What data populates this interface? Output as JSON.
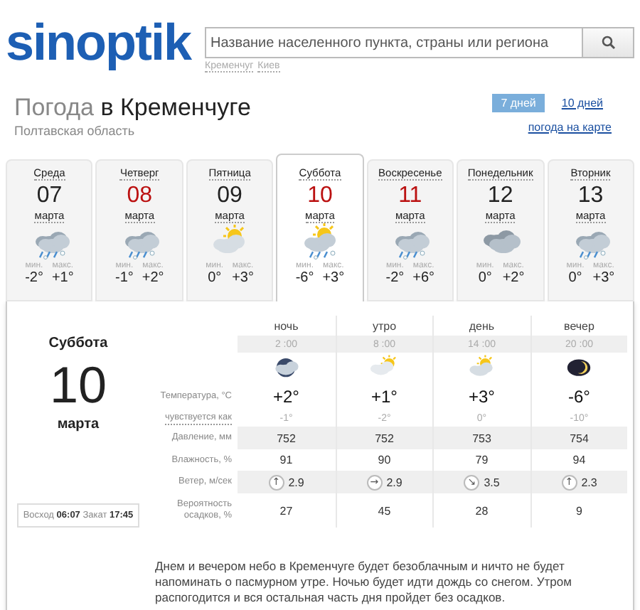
{
  "logo": {
    "text": "sinoptik"
  },
  "search": {
    "placeholder": "Название населенного пункта, страны или региона",
    "recent": [
      "Кременчуг",
      "Киев"
    ]
  },
  "title": {
    "prefix": "Погода",
    "city": "в Кременчуге",
    "region": "Полтавская область"
  },
  "views": [
    {
      "label": "7 дней",
      "selected": true
    },
    {
      "label": "10 дней",
      "selected": false
    }
  ],
  "map_link": "погода на карте",
  "days": [
    {
      "weekday": "Среда",
      "date": "07",
      "month": "марта",
      "holiday": false,
      "selected": false,
      "kind": "rain-snow",
      "min_label": "мин.",
      "min": "-2°",
      "max_label": "макс.",
      "max": "+1°"
    },
    {
      "weekday": "Четверг",
      "date": "08",
      "month": "марта",
      "holiday": true,
      "selected": false,
      "kind": "rain-snow",
      "min_label": "мин.",
      "min": "-1°",
      "max_label": "макс.",
      "max": "+2°"
    },
    {
      "weekday": "Пятница",
      "date": "09",
      "month": "марта",
      "holiday": false,
      "selected": false,
      "kind": "sun-cloud",
      "min_label": "мин.",
      "min": "0°",
      "max_label": "макс.",
      "max": "+3°"
    },
    {
      "weekday": "Суббота",
      "date": "10",
      "month": "марта",
      "holiday": true,
      "selected": true,
      "kind": "sun-rain-snow",
      "min_label": "мин.",
      "min": "-6°",
      "max_label": "макс.",
      "max": "+3°"
    },
    {
      "weekday": "Воскресенье",
      "date": "11",
      "month": "марта",
      "holiday": true,
      "selected": false,
      "kind": "rain-snow",
      "min_label": "мин.",
      "min": "-2°",
      "max_label": "макс.",
      "max": "+6°"
    },
    {
      "weekday": "Понедельник",
      "date": "12",
      "month": "марта",
      "holiday": false,
      "selected": false,
      "kind": "cloud",
      "min_label": "мин.",
      "min": "0°",
      "max_label": "макс.",
      "max": "+2°"
    },
    {
      "weekday": "Вторник",
      "date": "13",
      "month": "марта",
      "holiday": false,
      "selected": false,
      "kind": "rain-snow",
      "min_label": "мин.",
      "min": "0°",
      "max_label": "макс.",
      "max": "+3°"
    }
  ],
  "detail": {
    "weekday": "Суббота",
    "date": "10",
    "month": "марта",
    "sunrise_label": "Восход",
    "sunrise": "06:07",
    "sunset_label": "Закат",
    "sunset": "17:45",
    "row_labels": [
      "Температура, °C",
      "чувствуется как",
      "Давление, мм",
      "Влажность, %",
      "Ветер, м/сек",
      "Вероятность осадков, %"
    ],
    "periods": [
      {
        "name": "ночь",
        "time": "2 :00",
        "kind": "night-cloud",
        "temp": "+2°",
        "feels": "-1°",
        "pressure": "752",
        "humidity": "91",
        "wind_arrow": "↑",
        "wind": "2.9",
        "precip": "27"
      },
      {
        "name": "утро",
        "time": "8 :00",
        "kind": "sun-cloud-light",
        "temp": "+1°",
        "feels": "-2°",
        "pressure": "752",
        "humidity": "90",
        "wind_arrow": "→",
        "wind": "2.9",
        "precip": "45"
      },
      {
        "name": "день",
        "time": "14 :00",
        "kind": "sun-cloud",
        "temp": "+3°",
        "feels": "0°",
        "pressure": "753",
        "humidity": "79",
        "wind_arrow": "↘",
        "wind": "3.5",
        "precip": "28"
      },
      {
        "name": "вечер",
        "time": "20 :00",
        "kind": "moon",
        "temp": "-6°",
        "feels": "-10°",
        "pressure": "754",
        "humidity": "94",
        "wind_arrow": "↑",
        "wind": "2.3",
        "precip": "9"
      }
    ],
    "description": "Днем и вечером небо в Кременчуге будет безоблачным и ничто не будет напоминать о пасмурном утре. Ночью будет идти дождь со снегом. Утром распогодится и вся остальная часть дня пройдет без осадков."
  }
}
